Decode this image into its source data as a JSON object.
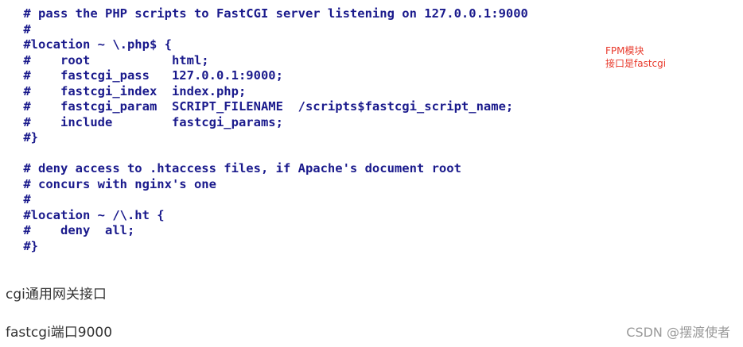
{
  "code_block": {
    "lines": [
      " # pass the PHP scripts to FastCGI server listening on 127.0.0.1:9000",
      " #",
      " #location ~ \\.php$ {",
      " #    root           html;",
      " #    fastcgi_pass   127.0.0.1:9000;",
      " #    fastcgi_index  index.php;",
      " #    fastcgi_param  SCRIPT_FILENAME  /scripts$fastcgi_script_name;",
      " #    include        fastcgi_params;",
      " #}",
      "",
      " # deny access to .htaccess files, if Apache's document root",
      " # concurs with nginx's one",
      " #",
      " #location ~ /\\.ht {",
      " #    deny  all;",
      " #}"
    ]
  },
  "annotation": {
    "line1": "FPM模块",
    "line2": "接口是fastcgi"
  },
  "paragraphs": {
    "p1": "cgi通用网关接口",
    "p2": "fastcgi端口9000"
  },
  "watermark": "CSDN @摆渡使者",
  "colors": {
    "code_text": "#1a1a8c",
    "annotation_text": "#e8392b",
    "body_text": "#333333",
    "watermark_text": "#9a9a9a"
  }
}
